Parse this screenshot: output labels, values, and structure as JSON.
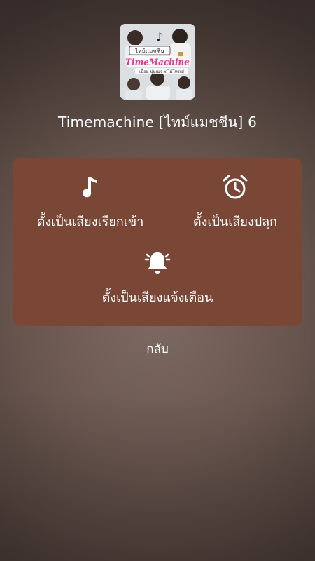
{
  "song": {
    "title": "Timemachine [ไทม์แมชชีน] 6",
    "cover_badge": "ไทม์แมชชีน",
    "cover_logo": "TimeMachine",
    "cover_credit": "เนื้อม นุ่มเมจ x ไม้โทรเม่"
  },
  "options": [
    {
      "label": "ตั้งเป็นเสียงเรียกเข้า",
      "icon": "music-note-icon"
    },
    {
      "label": "ตั้งเป็นเสียงปลุก",
      "icon": "alarm-clock-icon"
    },
    {
      "label": "ตั้งเป็นเสียงแจ้งเตือน",
      "icon": "bell-icon"
    }
  ],
  "back_label": "กลับ",
  "colors": {
    "panel": "#7a4737",
    "text": "#ffffff",
    "background": "#6a5750"
  }
}
